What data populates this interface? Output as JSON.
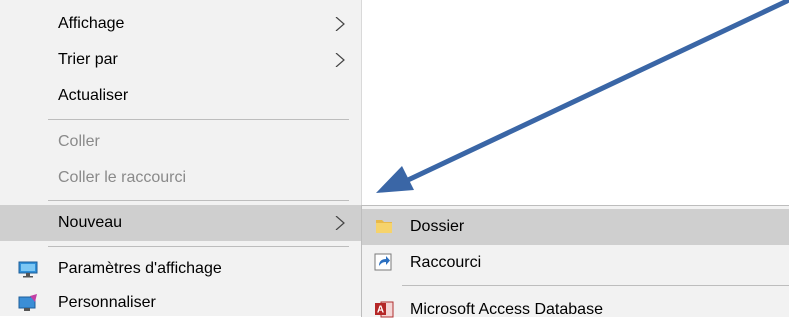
{
  "main_menu": {
    "items": [
      {
        "label": "Affichage",
        "submenu": true
      },
      {
        "label": "Trier par",
        "submenu": true
      },
      {
        "label": "Actualiser"
      },
      {
        "label": "Coller",
        "disabled": true
      },
      {
        "label": "Coller le raccourci",
        "disabled": true
      },
      {
        "label": "Nouveau",
        "submenu": true,
        "highlighted": true
      },
      {
        "label": "Paramètres d'affichage",
        "icon": "display-settings-icon"
      },
      {
        "label": "Personnaliser",
        "icon": "personalize-icon"
      }
    ]
  },
  "sub_menu": {
    "items": [
      {
        "label": "Dossier",
        "icon": "folder-icon",
        "highlighted": true
      },
      {
        "label": "Raccourci",
        "icon": "shortcut-icon"
      },
      {
        "label": "Microsoft Access Database",
        "icon": "access-icon"
      }
    ]
  },
  "annotation": {
    "type": "arrow",
    "color": "#3a66a6",
    "points_to": "sub-menu"
  },
  "colors": {
    "menu_bg": "#f2f2f2",
    "highlight": "#cfcfcf",
    "disabled_text": "#8a8a8a",
    "separator": "#bdbdbd"
  }
}
